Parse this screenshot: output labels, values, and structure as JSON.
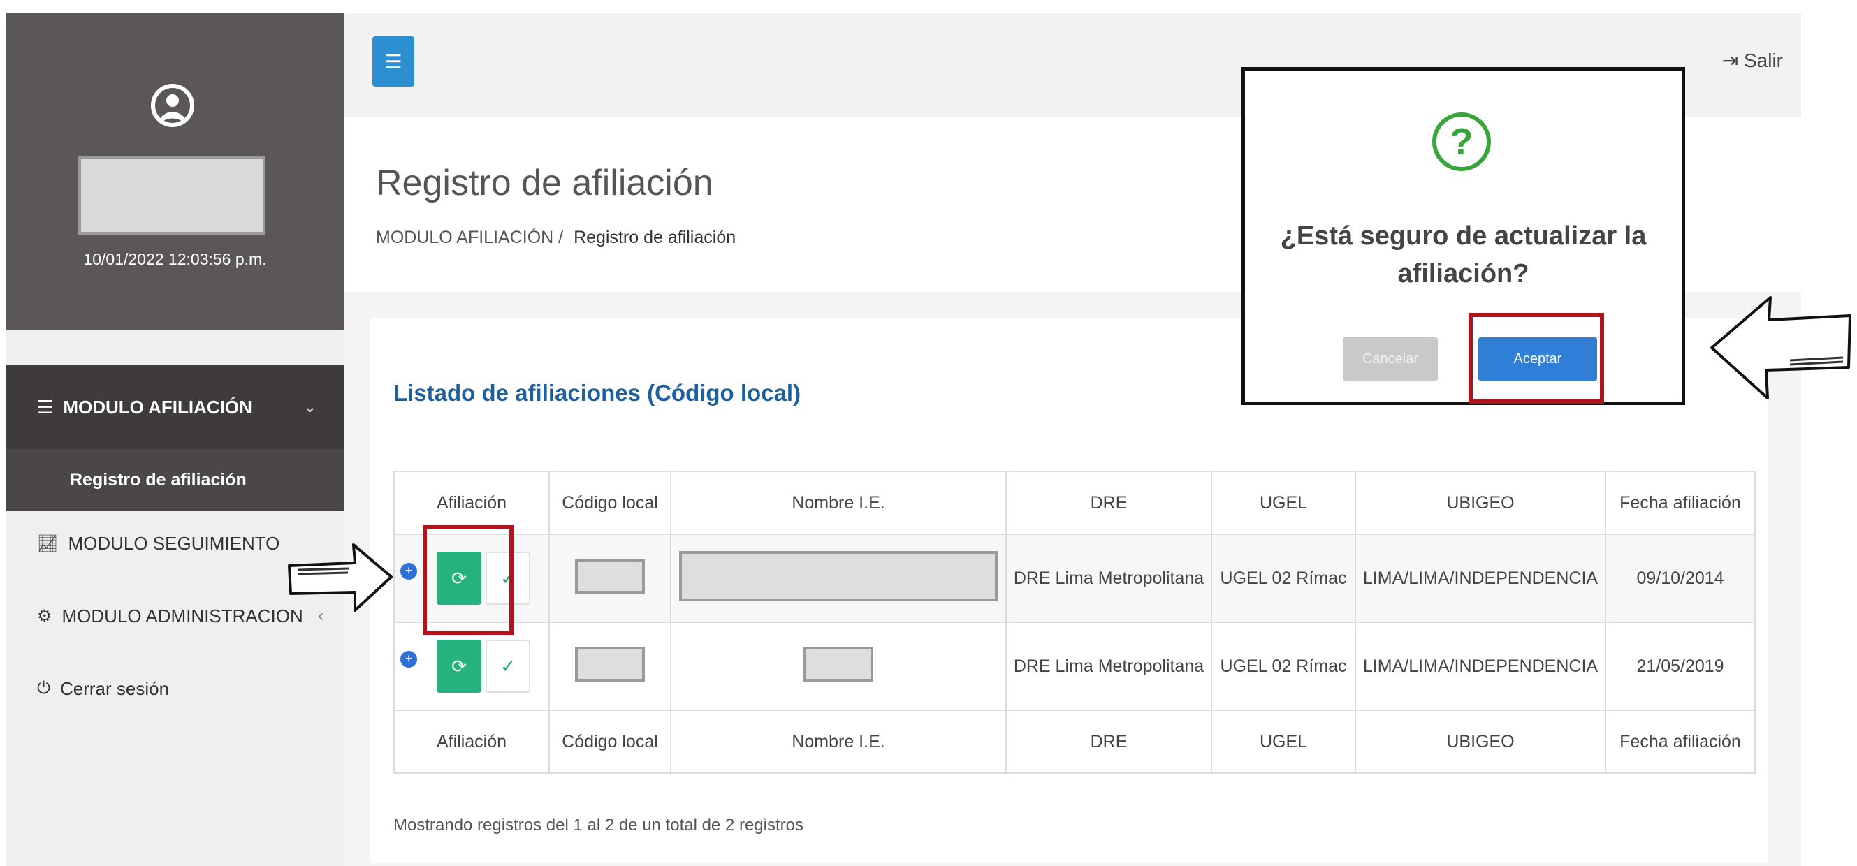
{
  "sidebar": {
    "datetime": "10/01/2022 12:03:56 p.m.",
    "module_afiliacion": "MODULO AFILIACIÓN",
    "registro": "Registro de afiliación",
    "module_seguimiento": "MODULO SEGUIMIENTO",
    "module_administracion": "MODULO ADMINISTRACION",
    "cerrar": "Cerrar sesión"
  },
  "topbar": {
    "salir": "Salir"
  },
  "header": {
    "title": "Registro de afiliación",
    "breadcrumb_root": "MODULO AFILIACIÓN /",
    "breadcrumb_current": "Registro de afiliación"
  },
  "card": {
    "title": "Listado de afiliaciones (Código local)"
  },
  "table": {
    "headers": [
      "Afiliación",
      "Código local",
      "Nombre I.E.",
      "DRE",
      "UGEL",
      "UBIGEO",
      "Fecha afiliación"
    ],
    "rows": [
      {
        "dre": "DRE Lima Metropolitana",
        "ugel": "UGEL 02 Rímac",
        "ubigeo": "LIMA/LIMA/INDEPENDENCIA",
        "fecha": "09/10/2014"
      },
      {
        "dre": "DRE Lima Metropolitana",
        "ugel": "UGEL 02 Rímac",
        "ubigeo": "LIMA/LIMA/INDEPENDENCIA",
        "fecha": "21/05/2019"
      }
    ]
  },
  "status": "Mostrando registros del 1 al 2 de un total de 2 registros",
  "dialog": {
    "message": "¿Está seguro de actualizar la afiliación?",
    "cancel": "Cancelar",
    "accept": "Aceptar"
  },
  "colors": {
    "accent": "#2c8fd0",
    "success": "#26b27e",
    "highlight": "#b0141c",
    "sidebar": "#5b5756"
  }
}
